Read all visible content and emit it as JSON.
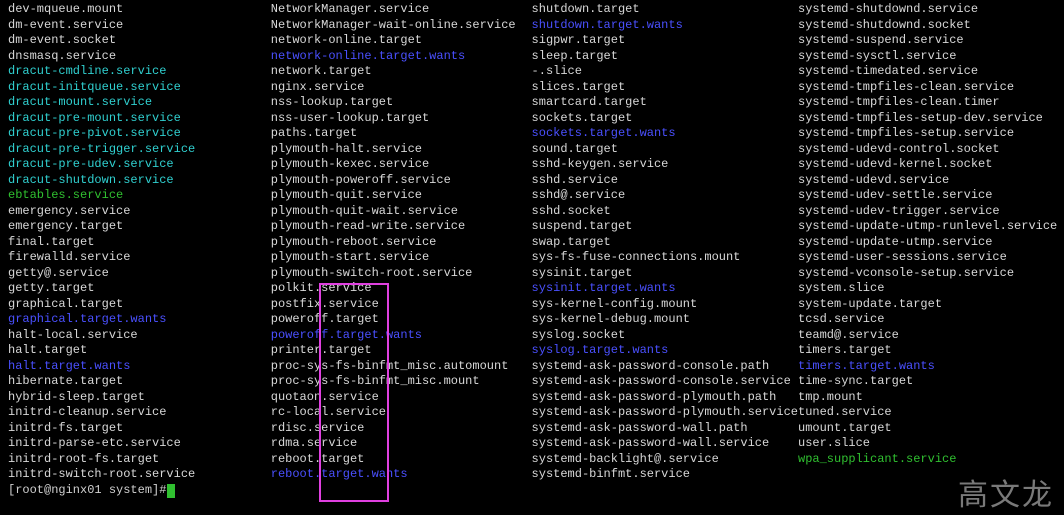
{
  "watermark": "高文龙",
  "prompt": "[root@nginx01 system]# ",
  "columns": [
    [
      {
        "text": "dev-mqueue.mount",
        "style": "white"
      },
      {
        "text": "dm-event.service",
        "style": "white"
      },
      {
        "text": "dm-event.socket",
        "style": "white"
      },
      {
        "text": "dnsmasq.service",
        "style": "white"
      },
      {
        "text": "dracut-cmdline.service",
        "style": "cyan"
      },
      {
        "text": "dracut-initqueue.service",
        "style": "cyan"
      },
      {
        "text": "dracut-mount.service",
        "style": "cyan"
      },
      {
        "text": "dracut-pre-mount.service",
        "style": "cyan"
      },
      {
        "text": "dracut-pre-pivot.service",
        "style": "cyan"
      },
      {
        "text": "dracut-pre-trigger.service",
        "style": "cyan"
      },
      {
        "text": "dracut-pre-udev.service",
        "style": "cyan"
      },
      {
        "text": "dracut-shutdown.service",
        "style": "cyan"
      },
      {
        "text": "ebtables.service",
        "style": "green"
      },
      {
        "text": "emergency.service",
        "style": "white"
      },
      {
        "text": "emergency.target",
        "style": "white"
      },
      {
        "text": "final.target",
        "style": "white"
      },
      {
        "text": "firewalld.service",
        "style": "white"
      },
      {
        "text": "getty@.service",
        "style": "white"
      },
      {
        "text": "getty.target",
        "style": "white"
      },
      {
        "text": "graphical.target",
        "style": "white"
      },
      {
        "text": "graphical.target.wants",
        "style": "blue"
      },
      {
        "text": "halt-local.service",
        "style": "white"
      },
      {
        "text": "halt.target",
        "style": "white"
      },
      {
        "text": "halt.target.wants",
        "style": "blue"
      },
      {
        "text": "hibernate.target",
        "style": "white"
      },
      {
        "text": "hybrid-sleep.target",
        "style": "white"
      },
      {
        "text": "initrd-cleanup.service",
        "style": "white"
      },
      {
        "text": "initrd-fs.target",
        "style": "white"
      },
      {
        "text": "initrd-parse-etc.service",
        "style": "white"
      },
      {
        "text": "initrd-root-fs.target",
        "style": "white"
      },
      {
        "text": "initrd-switch-root.service",
        "style": "white"
      }
    ],
    [
      {
        "text": "NetworkManager.service",
        "style": "white"
      },
      {
        "text": "NetworkManager-wait-online.service",
        "style": "white"
      },
      {
        "text": "network-online.target",
        "style": "white"
      },
      {
        "text": "network-online.target.wants",
        "style": "blue"
      },
      {
        "text": "network.target",
        "style": "white"
      },
      {
        "text": "nginx.service",
        "style": "white"
      },
      {
        "text": "nss-lookup.target",
        "style": "white"
      },
      {
        "text": "nss-user-lookup.target",
        "style": "white"
      },
      {
        "text": "paths.target",
        "style": "white"
      },
      {
        "text": "plymouth-halt.service",
        "style": "white"
      },
      {
        "text": "plymouth-kexec.service",
        "style": "white"
      },
      {
        "text": "plymouth-poweroff.service",
        "style": "white"
      },
      {
        "text": "plymouth-quit.service",
        "style": "white"
      },
      {
        "text": "plymouth-quit-wait.service",
        "style": "white"
      },
      {
        "text": "plymouth-read-write.service",
        "style": "white"
      },
      {
        "text": "plymouth-reboot.service",
        "style": "white"
      },
      {
        "text": "plymouth-start.service",
        "style": "white"
      },
      {
        "text": "plymouth-switch-root.service",
        "style": "white"
      },
      {
        "text": "polkit.service",
        "style": "white"
      },
      {
        "text": "postfix.service",
        "style": "white"
      },
      {
        "text": "poweroff.target",
        "style": "white"
      },
      {
        "text": "poweroff.target.wants",
        "style": "blue"
      },
      {
        "text": "printer.target",
        "style": "white"
      },
      {
        "text": "proc-sys-fs-binfmt_misc.automount",
        "style": "white"
      },
      {
        "text": "proc-sys-fs-binfmt_misc.mount",
        "style": "white"
      },
      {
        "text": "quotaon.service",
        "style": "white"
      },
      {
        "text": "rc-local.service",
        "style": "white"
      },
      {
        "text": "rdisc.service",
        "style": "white"
      },
      {
        "text": "rdma.service",
        "style": "white"
      },
      {
        "text": "reboot.target",
        "style": "white"
      },
      {
        "text": "reboot.target.wants",
        "style": "blue"
      }
    ],
    [
      {
        "text": "shutdown.target",
        "style": "white"
      },
      {
        "text": "shutdown.target.wants",
        "style": "blue"
      },
      {
        "text": "sigpwr.target",
        "style": "white"
      },
      {
        "text": "sleep.target",
        "style": "white"
      },
      {
        "text": "-.slice",
        "style": "white"
      },
      {
        "text": "slices.target",
        "style": "white"
      },
      {
        "text": "smartcard.target",
        "style": "white"
      },
      {
        "text": "sockets.target",
        "style": "white"
      },
      {
        "text": "sockets.target.wants",
        "style": "blue"
      },
      {
        "text": "sound.target",
        "style": "white"
      },
      {
        "text": "sshd-keygen.service",
        "style": "white"
      },
      {
        "text": "sshd.service",
        "style": "white"
      },
      {
        "text": "sshd@.service",
        "style": "white"
      },
      {
        "text": "sshd.socket",
        "style": "white"
      },
      {
        "text": "suspend.target",
        "style": "white"
      },
      {
        "text": "swap.target",
        "style": "white"
      },
      {
        "text": "sys-fs-fuse-connections.mount",
        "style": "white"
      },
      {
        "text": "sysinit.target",
        "style": "white"
      },
      {
        "text": "sysinit.target.wants",
        "style": "blue"
      },
      {
        "text": "sys-kernel-config.mount",
        "style": "white"
      },
      {
        "text": "sys-kernel-debug.mount",
        "style": "white"
      },
      {
        "text": "syslog.socket",
        "style": "white"
      },
      {
        "text": "syslog.target.wants",
        "style": "blue"
      },
      {
        "text": "systemd-ask-password-console.path",
        "style": "white"
      },
      {
        "text": "systemd-ask-password-console.service",
        "style": "white"
      },
      {
        "text": "systemd-ask-password-plymouth.path",
        "style": "white"
      },
      {
        "text": "systemd-ask-password-plymouth.service",
        "style": "white"
      },
      {
        "text": "systemd-ask-password-wall.path",
        "style": "white"
      },
      {
        "text": "systemd-ask-password-wall.service",
        "style": "white"
      },
      {
        "text": "systemd-backlight@.service",
        "style": "white"
      },
      {
        "text": "systemd-binfmt.service",
        "style": "white"
      }
    ],
    [
      {
        "text": "systemd-shutdownd.service",
        "style": "white"
      },
      {
        "text": "systemd-shutdownd.socket",
        "style": "white"
      },
      {
        "text": "systemd-suspend.service",
        "style": "white"
      },
      {
        "text": "systemd-sysctl.service",
        "style": "white"
      },
      {
        "text": "systemd-timedated.service",
        "style": "white"
      },
      {
        "text": "systemd-tmpfiles-clean.service",
        "style": "white"
      },
      {
        "text": "systemd-tmpfiles-clean.timer",
        "style": "white"
      },
      {
        "text": "systemd-tmpfiles-setup-dev.service",
        "style": "white"
      },
      {
        "text": "systemd-tmpfiles-setup.service",
        "style": "white"
      },
      {
        "text": "systemd-udevd-control.socket",
        "style": "white"
      },
      {
        "text": "systemd-udevd-kernel.socket",
        "style": "white"
      },
      {
        "text": "systemd-udevd.service",
        "style": "white"
      },
      {
        "text": "systemd-udev-settle.service",
        "style": "white"
      },
      {
        "text": "systemd-udev-trigger.service",
        "style": "white"
      },
      {
        "text": "systemd-update-utmp-runlevel.service",
        "style": "white"
      },
      {
        "text": "systemd-update-utmp.service",
        "style": "white"
      },
      {
        "text": "systemd-user-sessions.service",
        "style": "white"
      },
      {
        "text": "systemd-vconsole-setup.service",
        "style": "white"
      },
      {
        "text": "system.slice",
        "style": "white"
      },
      {
        "text": "system-update.target",
        "style": "white"
      },
      {
        "text": "tcsd.service",
        "style": "white"
      },
      {
        "text": "teamd@.service",
        "style": "white"
      },
      {
        "text": "timers.target",
        "style": "white"
      },
      {
        "text": "timers.target.wants",
        "style": "blue"
      },
      {
        "text": "time-sync.target",
        "style": "white"
      },
      {
        "text": "tmp.mount",
        "style": "white"
      },
      {
        "text": "tuned.service",
        "style": "white"
      },
      {
        "text": "umount.target",
        "style": "white"
      },
      {
        "text": "user.slice",
        "style": "white"
      },
      {
        "text": "wpa_supplicant.service",
        "style": "green"
      }
    ]
  ]
}
